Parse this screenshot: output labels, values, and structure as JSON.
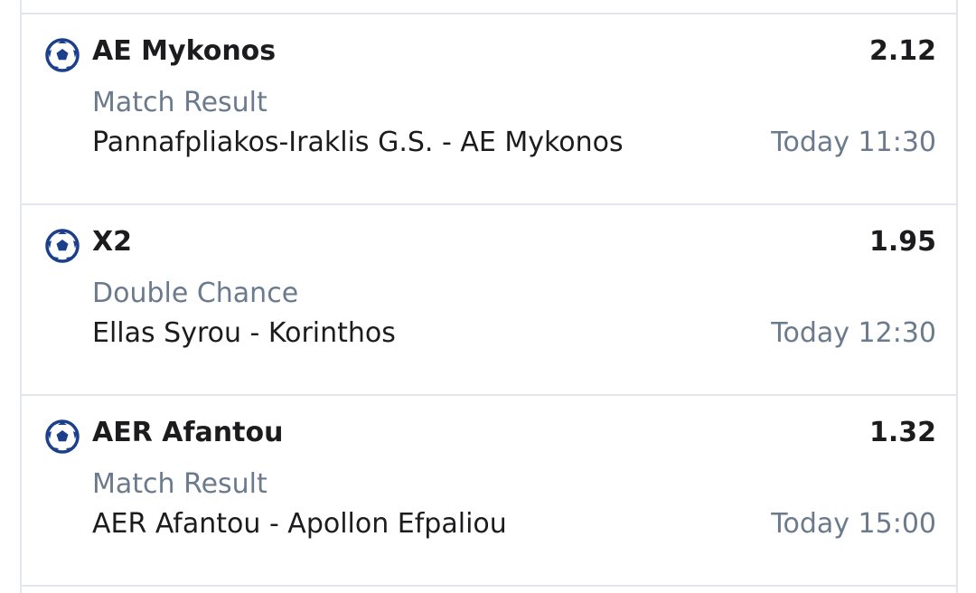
{
  "bets": [
    {
      "sport_icon": "football-icon",
      "selection": "AE Mykonos",
      "odds": "2.12",
      "market": "Match Result",
      "match": "Pannafpliakos-Iraklis G.S. - AE Mykonos",
      "time": "Today 11:30"
    },
    {
      "sport_icon": "football-icon",
      "selection": "X2",
      "odds": "1.95",
      "market": "Double Chance",
      "match": "Ellas Syrou - Korinthos",
      "time": "Today 12:30"
    },
    {
      "sport_icon": "football-icon",
      "selection": "AER Afantou",
      "odds": "1.32",
      "market": "Match Result",
      "match": "AER Afantou - Apollon Efpaliou",
      "time": "Today 15:00"
    }
  ],
  "colors": {
    "text_primary": "#1c1c1e",
    "text_secondary": "#6b7a8c",
    "divider": "#e3e6ea",
    "icon_blue": "#1b3f8b"
  }
}
